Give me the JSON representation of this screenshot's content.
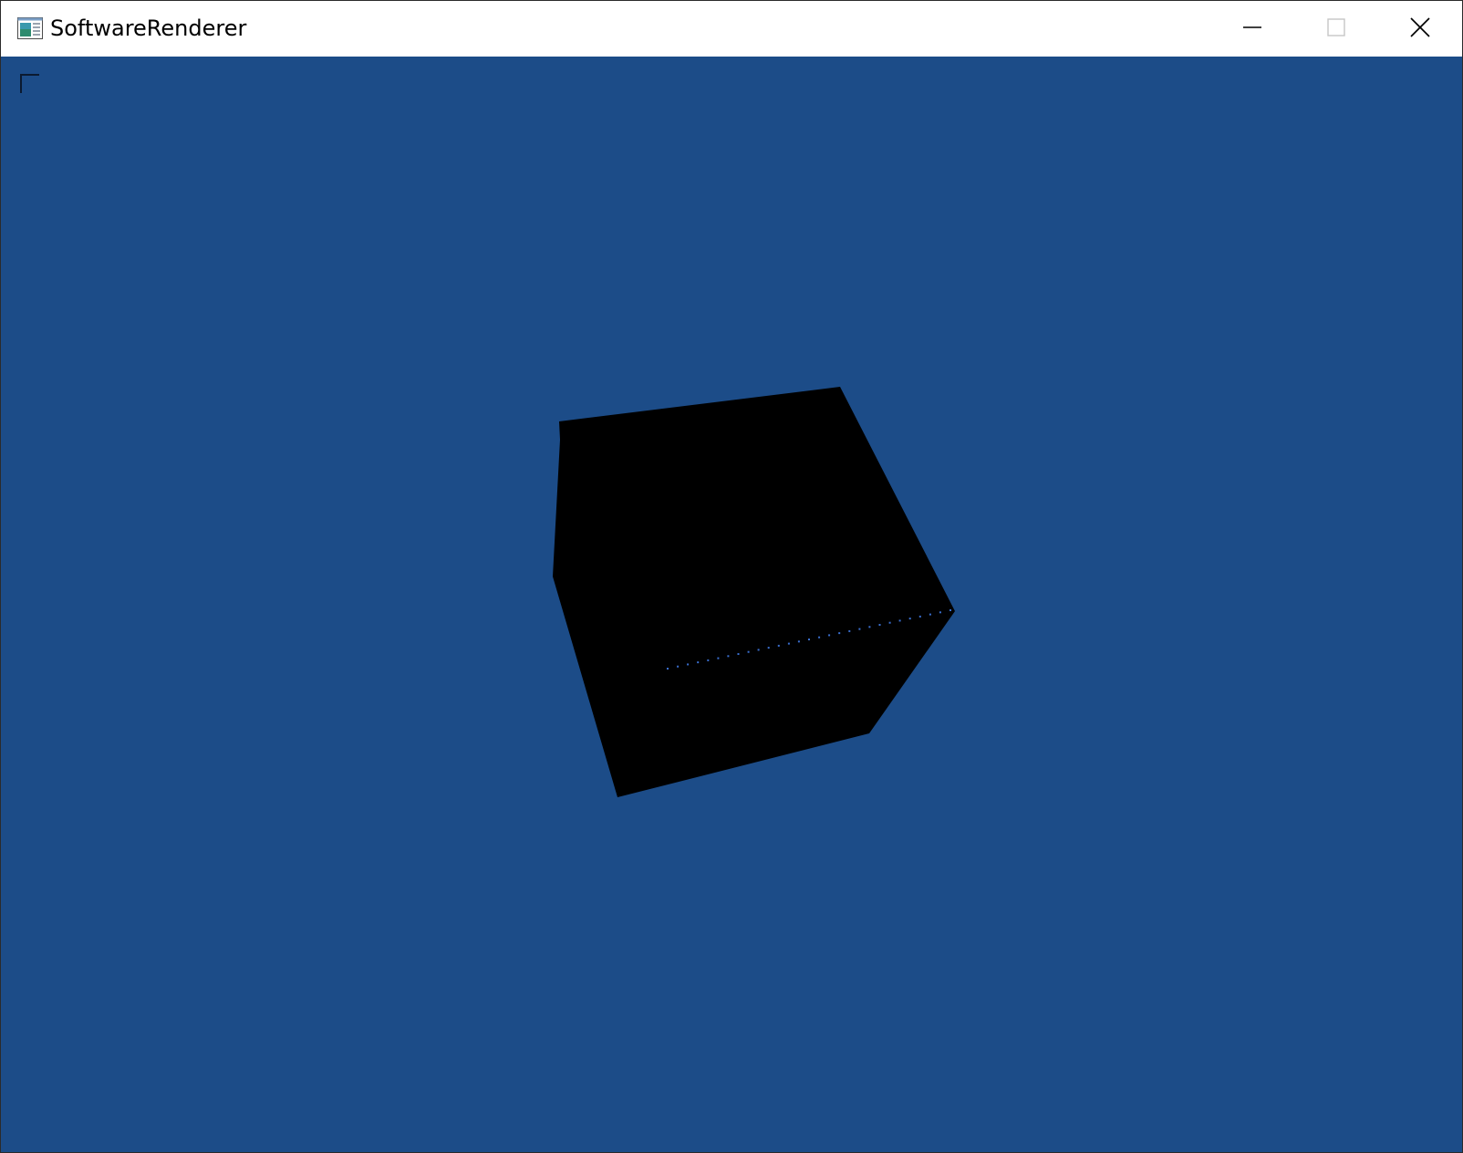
{
  "window": {
    "title": "SoftwareRenderer"
  },
  "titlebar_buttons": [
    {
      "name": "minimize",
      "icon": "minimize-icon"
    },
    {
      "name": "maximize",
      "icon": "maximize-icon"
    },
    {
      "name": "close",
      "icon": "close-icon"
    }
  ],
  "viewport": {
    "background_color": "#1c4c88",
    "cube_color": "#000000",
    "edge_dot_color": "#3a6fd0",
    "corner_marker_color": "#0b1a30"
  },
  "colors": {
    "titlebar_bg": "#ffffff",
    "title_text": "#000000",
    "window_border": "#2b2b2b"
  }
}
